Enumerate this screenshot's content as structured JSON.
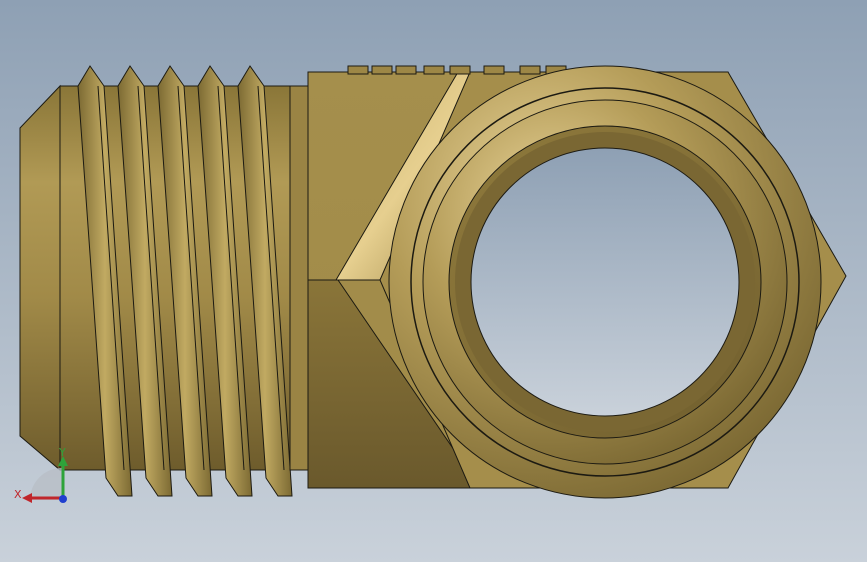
{
  "viewport": {
    "background_top": "#8ea0b4",
    "background_bottom": "#c9d1da"
  },
  "part": {
    "color_base": "#a8924e",
    "color_light": "#e8d49a",
    "color_dark": "#6b5a2e",
    "color_edge": "#1c1a12"
  },
  "triad": {
    "x_label": "X",
    "y_label": "Y",
    "x_color": "#c0262b",
    "y_color": "#2ea33a",
    "z_color": "#1f3fcf"
  }
}
